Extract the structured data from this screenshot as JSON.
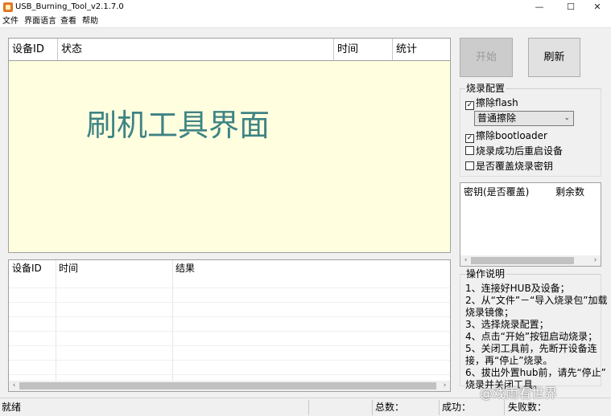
{
  "window": {
    "title": "USB_Burning_Tool_v2.1.7.0",
    "controls": {
      "minimize": "—",
      "maximize": "☐",
      "close": "✕"
    }
  },
  "menu": [
    "文件",
    "界面语言",
    "查看",
    "帮助"
  ],
  "main_table": {
    "columns": [
      "设备ID",
      "状态",
      "时间",
      "统计"
    ],
    "overlay_text": "刷机工具界面",
    "background": "#ffffe0",
    "overlay_color": "#3e8383"
  },
  "log_table": {
    "columns": [
      "设备ID",
      "时间",
      "结果"
    ]
  },
  "buttons": {
    "start": "开始",
    "refresh": "刷新"
  },
  "burn_config": {
    "title": "烧录配置",
    "erase_flash": {
      "label": "擦除flash",
      "checked": true
    },
    "erase_mode": {
      "selected": "普通擦除"
    },
    "erase_bootloader": {
      "label": "擦除bootloader",
      "checked": true
    },
    "reboot_after": {
      "label": "烧录成功后重启设备",
      "checked": false
    },
    "overwrite_key": {
      "label": "是否覆盖烧录密钥",
      "checked": false
    }
  },
  "key_table": {
    "columns": [
      "密钥(是否覆盖)",
      "剩余数"
    ]
  },
  "instructions": {
    "title": "操作说明",
    "lines": [
      "1、连接好HUB及设备；",
      "2、从“文件”－“导入烧录包”加载",
      "烧录镜像；",
      "3、选择烧录配置；",
      "4、点击“开始”按钮启动烧录；",
      "5、关闭工具前，先断开设备连",
      "接，再“停止”烧录。",
      "6、拔出外置hub前，请先“停止”",
      "烧录并关闭工具。"
    ]
  },
  "status": {
    "state": "就绪",
    "total_label": "总数：",
    "success_label": "成功：",
    "fail_label": "失败数："
  },
  "watermark": "@戏雨看世界",
  "icons": {
    "check": "✓",
    "dropdown": "⌄",
    "left": "‹",
    "right": "›"
  }
}
